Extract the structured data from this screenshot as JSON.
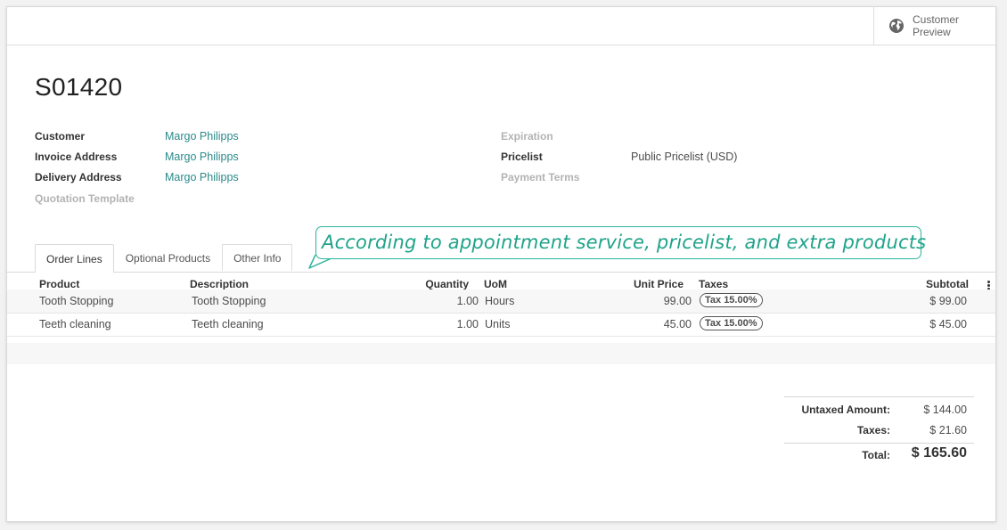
{
  "smart_button": {
    "label_line1": "Customer",
    "label_line2": "Preview"
  },
  "record": {
    "title": "S01420"
  },
  "left_fields": [
    {
      "label": "Customer",
      "value": "Margo Philipps"
    },
    {
      "label": "Invoice Address",
      "value": "Margo Philipps"
    },
    {
      "label": "Delivery Address",
      "value": "Margo Philipps"
    },
    {
      "label": "Quotation Template",
      "value": ""
    }
  ],
  "right_fields": [
    {
      "label": "Expiration",
      "value": ""
    },
    {
      "label": "Pricelist",
      "value": "Public Pricelist (USD)"
    },
    {
      "label": "Payment Terms",
      "value": ""
    }
  ],
  "tabs": [
    {
      "label": "Order Lines"
    },
    {
      "label": "Optional Products"
    },
    {
      "label": "Other Info"
    }
  ],
  "callout": {
    "text": "According to appointment service, pricelist, and extra products"
  },
  "table": {
    "columns": [
      "Product",
      "Description",
      "Quantity",
      "UoM",
      "Unit Price",
      "Taxes",
      "Subtotal"
    ],
    "rows": [
      {
        "product": "Tooth Stopping",
        "description": "Tooth Stopping",
        "quantity": "1.00",
        "uom": "Hours",
        "unit_price": "99.00",
        "tax": "Tax 15.00%",
        "subtotal": "$ 99.00"
      },
      {
        "product": "Teeth cleaning",
        "description": "Teeth cleaning",
        "quantity": "1.00",
        "uom": "Units",
        "unit_price": "45.00",
        "tax": "Tax 15.00%",
        "subtotal": "$ 45.00"
      }
    ]
  },
  "totals": {
    "untaxed_label": "Untaxed Amount:",
    "untaxed_value": "$ 144.00",
    "taxes_label": "Taxes:",
    "taxes_value": "$ 21.60",
    "total_label": "Total:",
    "total_value": "$ 165.60"
  },
  "colors": {
    "link": "#2b8a8a",
    "callout": "#1fa38a",
    "muted": "#b3b3b3"
  },
  "icons": {
    "smart_button": "globe-icon",
    "row_options": "kebab-menu-icon"
  }
}
